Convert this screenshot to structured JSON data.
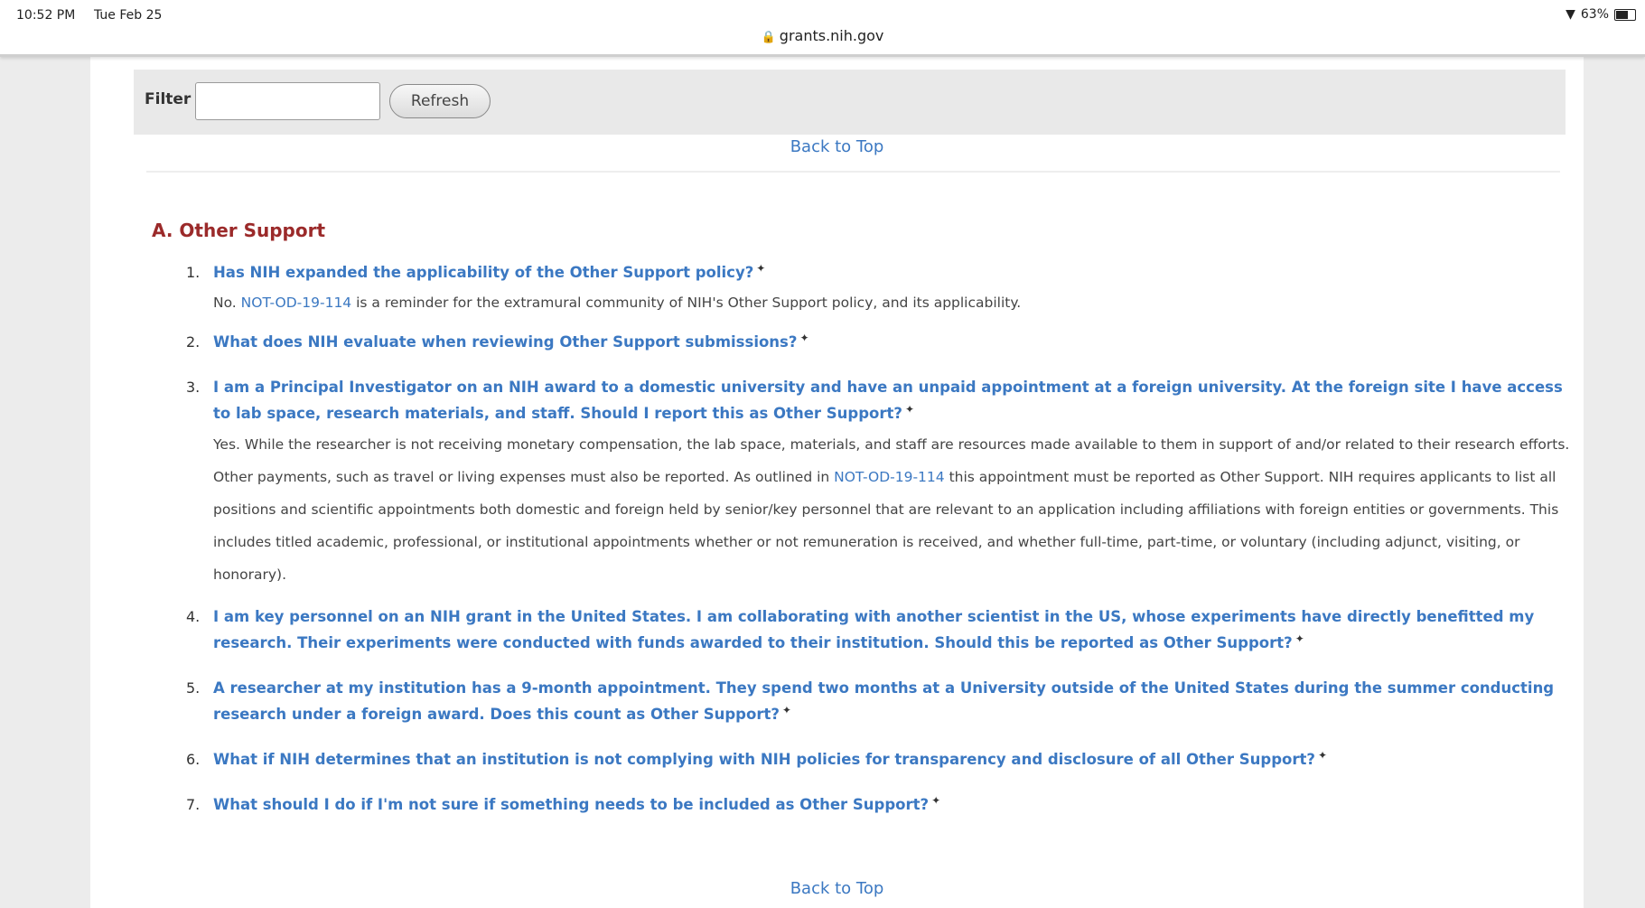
{
  "status_bar": {
    "time": "10:52 PM",
    "date": "Tue Feb 25",
    "battery": "63%"
  },
  "browser": {
    "url": "grants.nih.gov"
  },
  "filter": {
    "label": "Filter",
    "input_value": "",
    "refresh_label": "Refresh"
  },
  "nav": {
    "back_to_top": "Back to Top"
  },
  "section": {
    "heading": "A. Other Support",
    "items": [
      {
        "number": "1.",
        "question": "Has NIH expanded the applicability of the Other Support policy?",
        "answer_start": "No. ",
        "answer_link": "NOT-OD-19-114",
        "answer_end": " is a reminder for the extramural community of NIH's Other Support policy, and its applicability."
      },
      {
        "number": "2.",
        "question": "What does NIH evaluate when reviewing Other Support submissions?"
      },
      {
        "number": "3.",
        "question": "I am a Principal Investigator on an NIH award to a domestic university and have an unpaid appointment at a foreign university. At the foreign site I have access to lab space, research materials, and staff. Should I report this as Other Support?",
        "answer_start": "Yes. While the researcher is not receiving monetary compensation, the lab space, materials, and staff are resources made available to them in support of and/or related to their research efforts. Other payments, such as travel or living expenses must also be reported. As outlined in ",
        "answer_link": "NOT-OD-19-114",
        "answer_end": " this appointment must be reported as Other Support. NIH requires applicants to list all positions and scientific appointments both domestic and foreign held by senior/key personnel that are relevant to an application including affiliations with foreign entities or governments. This includes titled academic, professional, or institutional appointments whether or not remuneration is received, and whether full-time, part-time, or voluntary (including adjunct, visiting, or honorary)."
      },
      {
        "number": "4.",
        "question": "I am key personnel on an NIH grant in the United States. I am collaborating with another scientist in the US, whose experiments have directly benefitted my research. Their experiments were conducted with funds awarded to their institution. Should this be reported as Other Support?"
      },
      {
        "number": "5.",
        "question": "A researcher at my institution has a 9-month appointment. They spend two months at a University outside of the United States during the summer conducting research under a foreign award. Does this count as Other Support?"
      },
      {
        "number": "6.",
        "question": "What if NIH determines that an institution is not complying with NIH policies for transparency and disclosure of all Other Support?"
      },
      {
        "number": "7.",
        "question": "What should I do if I'm not sure if something needs to be included as Other Support?"
      }
    ]
  },
  "icons": {
    "expand": "expand-star-icon",
    "lock": "lock-icon",
    "wifi": "wifi-icon",
    "battery": "battery-icon"
  },
  "colors": {
    "link": "#3b78c2",
    "heading": "#9b2a2a",
    "body_text": "#444444",
    "filter_bar": "#e9e9e9"
  }
}
